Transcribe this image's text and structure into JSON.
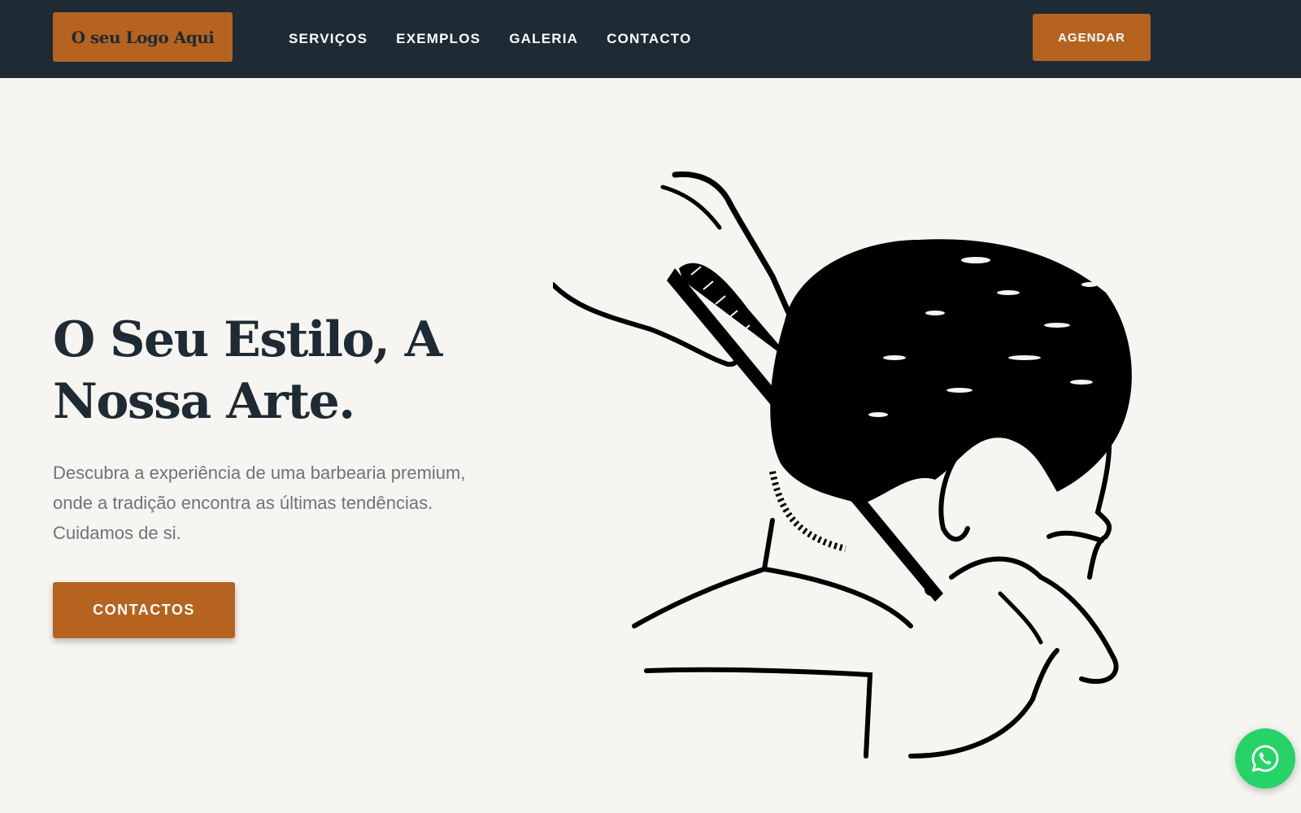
{
  "header": {
    "logo_text": "O seu Logo Aqui",
    "nav": [
      {
        "label": "SERVIÇOS"
      },
      {
        "label": "EXEMPLOS"
      },
      {
        "label": "GALERIA"
      },
      {
        "label": "CONTACTO"
      }
    ],
    "book_button": "AGENDAR"
  },
  "hero": {
    "title_line1": "O Seu Estilo, A",
    "title_line2": "Nossa Arte.",
    "description": "Descubra a experiência de uma barbearia premium, onde a tradição encontra as últimas tendências. Cuidamos de si.",
    "cta_button": "CONTACTOS",
    "illustration_icon": "barber-haircut-illustration"
  },
  "floating": {
    "whatsapp_icon": "whatsapp-icon"
  },
  "colors": {
    "nav_background": "#1e2a34",
    "accent": "#b5631f",
    "page_background": "#f7f5f1",
    "heading": "#1e2a34",
    "body_text": "#6e747a",
    "whatsapp": "#25d366"
  }
}
